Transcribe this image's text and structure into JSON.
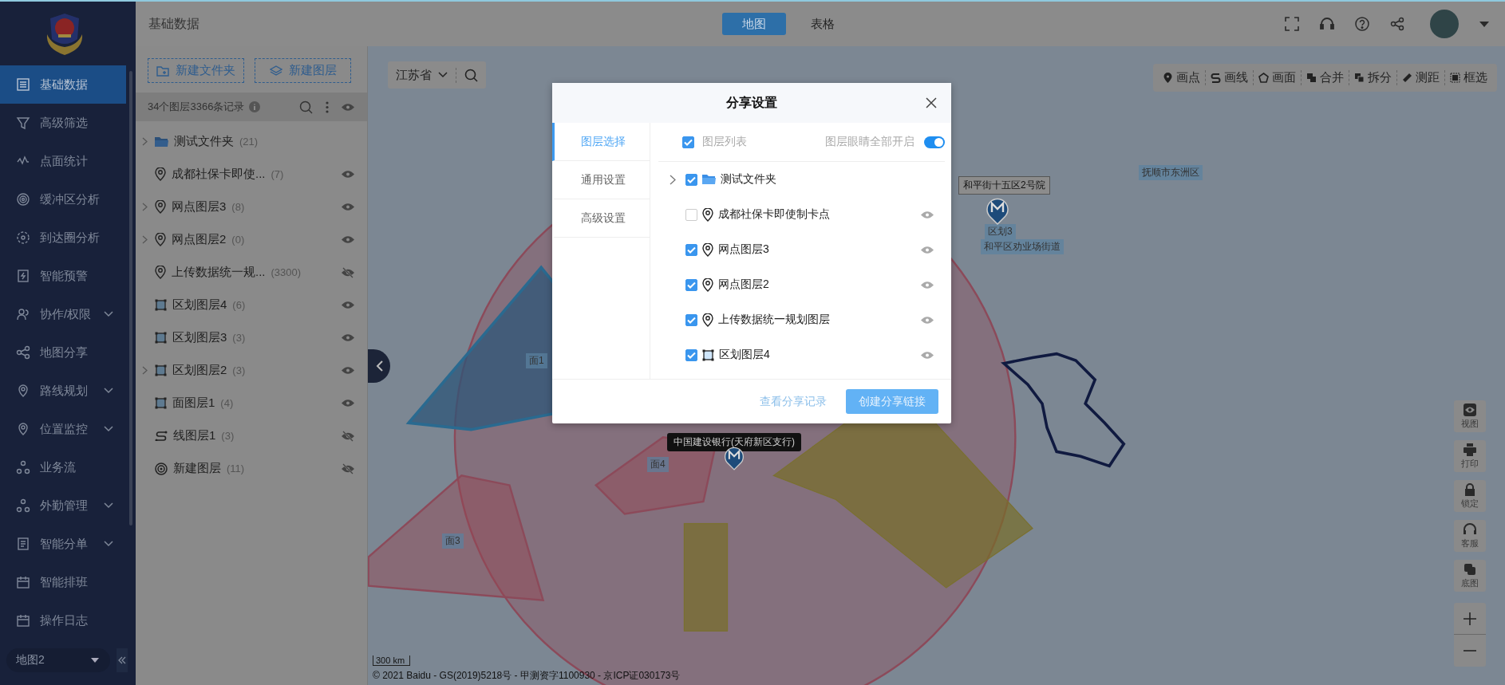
{
  "sidebar": {
    "items": [
      {
        "label": "基础数据",
        "selected": true,
        "expandable": false
      },
      {
        "label": "高级筛选",
        "selected": false,
        "expandable": false
      },
      {
        "label": "点面统计",
        "selected": false,
        "expandable": false
      },
      {
        "label": "缓冲区分析",
        "selected": false,
        "expandable": false
      },
      {
        "label": "到达圈分析",
        "selected": false,
        "expandable": false
      },
      {
        "label": "智能预警",
        "selected": false,
        "expandable": false
      },
      {
        "label": "协作/权限",
        "selected": false,
        "expandable": true
      },
      {
        "label": "地图分享",
        "selected": false,
        "expandable": false
      },
      {
        "label": "路线规划",
        "selected": false,
        "expandable": true
      },
      {
        "label": "位置监控",
        "selected": false,
        "expandable": true
      },
      {
        "label": "业务流",
        "selected": false,
        "expandable": false
      },
      {
        "label": "外勤管理",
        "selected": false,
        "expandable": true
      },
      {
        "label": "智能分单",
        "selected": false,
        "expandable": true
      },
      {
        "label": "智能排班",
        "selected": false,
        "expandable": false
      },
      {
        "label": "操作日志",
        "selected": false,
        "expandable": false
      }
    ],
    "map_select": "地图2"
  },
  "top_bar": {
    "title": "基础数据",
    "tabs": [
      {
        "label": "地图",
        "selected": true
      },
      {
        "label": "表格",
        "selected": false
      }
    ]
  },
  "layer_panel": {
    "buttons": [
      "新建文件夹",
      "新建图层"
    ],
    "summary": "34个图层3366条记录",
    "layers": [
      {
        "name": "测试文件夹",
        "count": "(21)",
        "kind": "folder",
        "expandable": true
      },
      {
        "name": "成都社保卡即使...",
        "count": "(7)",
        "kind": "point",
        "expandable": false,
        "visible": true
      },
      {
        "name": "网点图层3",
        "count": "(8)",
        "kind": "point",
        "expandable": true,
        "visible": true
      },
      {
        "name": "网点图层2",
        "count": "(0)",
        "kind": "point",
        "expandable": true,
        "visible": true
      },
      {
        "name": "上传数据统一规...",
        "count": "(3300)",
        "kind": "point",
        "expandable": false,
        "visible": false
      },
      {
        "name": "区划图层4",
        "count": "(6)",
        "kind": "region",
        "expandable": false,
        "visible": true
      },
      {
        "name": "区划图层3",
        "count": "(3)",
        "kind": "region",
        "expandable": false,
        "visible": true
      },
      {
        "name": "区划图层2",
        "count": "(3)",
        "kind": "region",
        "expandable": true,
        "visible": true
      },
      {
        "name": "面图层1",
        "count": "(4)",
        "kind": "region",
        "expandable": false,
        "visible": true
      },
      {
        "name": "线图层1",
        "count": "(3)",
        "kind": "line",
        "expandable": false,
        "visible": false
      },
      {
        "name": "新建图层",
        "count": "(11)",
        "kind": "buffer",
        "expandable": false,
        "visible": false
      }
    ]
  },
  "map": {
    "region_select": "江苏省",
    "tools": [
      "画点",
      "画线",
      "画面",
      "合并",
      "拆分",
      "测距",
      "框选"
    ],
    "labels": [
      {
        "text": "抚顺市东洲区",
        "kind": "shape"
      },
      {
        "text": "和平街十五区2号院",
        "kind": "box"
      },
      {
        "text": "区划3",
        "kind": "shape"
      },
      {
        "text": "和平区劝业场街道",
        "kind": "shape"
      },
      {
        "text": "面1",
        "kind": "shape"
      },
      {
        "text": "中国建设银行(天府新区支行)",
        "kind": "tooltip"
      },
      {
        "text": "面4",
        "kind": "shape"
      },
      {
        "text": "面3",
        "kind": "shape"
      }
    ],
    "side_tools": [
      "视图",
      "打印",
      "锁定",
      "客服",
      "底图"
    ],
    "scale": "300 km",
    "copyright": "© 2021 Baidu - GS(2019)5218号 - 甲测资字1100930 - 京ICP证030173号"
  },
  "dialog": {
    "title": "分享设置",
    "tabs": [
      {
        "label": "图层选择",
        "selected": true
      },
      {
        "label": "通用设置",
        "selected": false
      },
      {
        "label": "高级设置",
        "selected": false
      }
    ],
    "list_header": {
      "label": "图层列表",
      "checked": true
    },
    "eyes_toggle": {
      "label": "图层眼睛全部开启",
      "on": true
    },
    "layers": [
      {
        "name": "测试文件夹",
        "kind": "folder",
        "checked": true,
        "expandable": true
      },
      {
        "name": "成都社保卡即使制卡点",
        "kind": "point",
        "checked": false,
        "expandable": false,
        "visible": true
      },
      {
        "name": "网点图层3",
        "kind": "point",
        "checked": true,
        "expandable": false,
        "visible": true
      },
      {
        "name": "网点图层2",
        "kind": "point",
        "checked": true,
        "expandable": false,
        "visible": true
      },
      {
        "name": "上传数据统一规划图层",
        "kind": "point",
        "checked": true,
        "expandable": false,
        "visible": true
      },
      {
        "name": "区划图层4",
        "kind": "region",
        "checked": true,
        "expandable": false,
        "visible": true
      }
    ],
    "link": "查看分享记录",
    "primary": "创建分享链接"
  }
}
